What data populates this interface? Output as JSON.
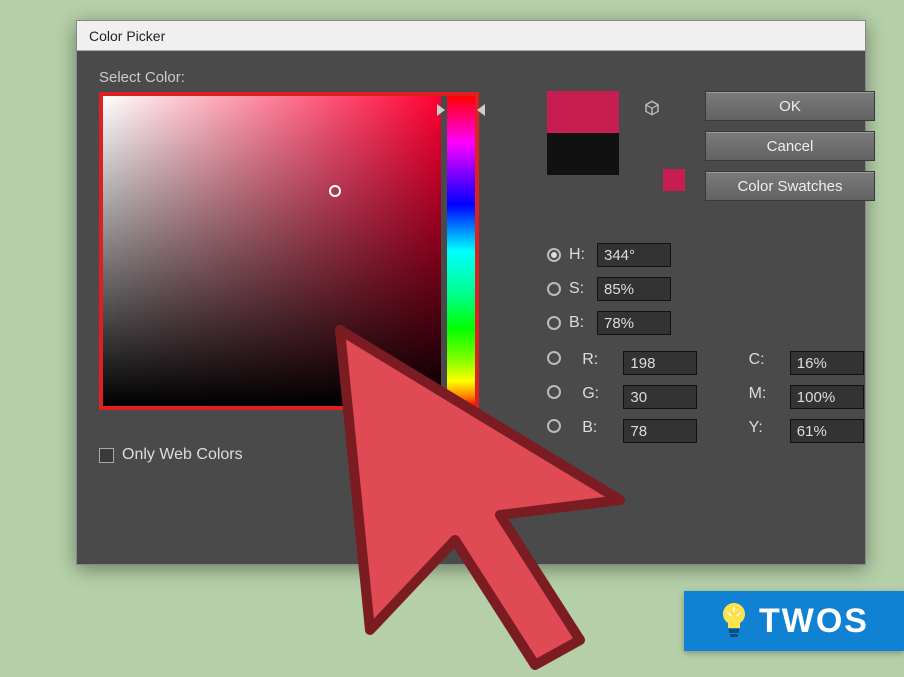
{
  "window": {
    "title": "Color Picker",
    "select_label": "Select Color:",
    "only_web_label": "Only Web Colors"
  },
  "preview": {
    "new_color": "#c71e52",
    "current_color": "#111111",
    "mini_swatch": "#c71e52"
  },
  "buttons": {
    "ok": "OK",
    "cancel": "Cancel",
    "swatches": "Color Swatches"
  },
  "hsb": {
    "selected_radio": "H",
    "H": {
      "label": "H:",
      "value": "344°"
    },
    "S": {
      "label": "S:",
      "value": "85%"
    },
    "B": {
      "label": "B:",
      "value": "78%"
    }
  },
  "rgb": {
    "R": {
      "label": "R:",
      "value": "198"
    },
    "G": {
      "label": "G:",
      "value": "30"
    },
    "B": {
      "label": "B:",
      "value": "78"
    }
  },
  "cmy": {
    "C": {
      "label": "C:",
      "value": "16%"
    },
    "M": {
      "label": "M:",
      "value": "100%"
    },
    "Y": {
      "label": "Y:",
      "value": "61%"
    }
  },
  "brand": {
    "text": "TWOS"
  },
  "icons": {
    "cube": "cube-icon",
    "cursor": "cursor-pointer-icon",
    "bulb": "lightbulb-icon"
  }
}
